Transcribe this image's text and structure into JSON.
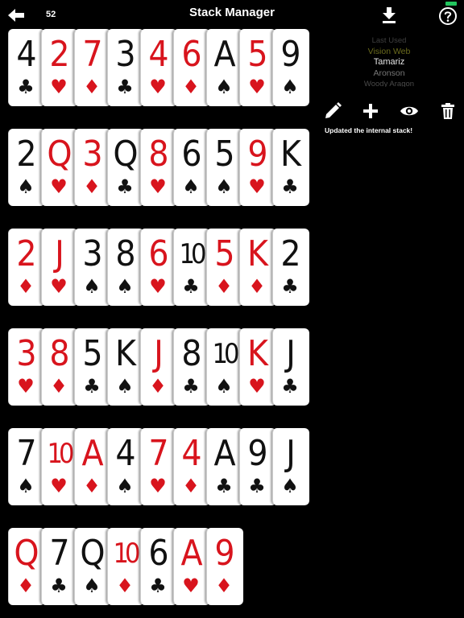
{
  "header": {
    "title": "Stack Manager",
    "card_count": "52",
    "back_icon": "arrow-left-icon",
    "download_icon": "download-icon",
    "help_icon": "question-circle-icon",
    "battery_color": "#22c55e"
  },
  "stack_picker": {
    "options": [
      "Last Used",
      "Vision Web",
      "Tamariz",
      "Aronson",
      "Woody Aragon"
    ],
    "selected": "Tamariz"
  },
  "actions": {
    "icons": [
      "pencil-icon",
      "plus-icon",
      "eye-icon",
      "trash-icon"
    ]
  },
  "status_message": "Updated the internal stack!",
  "colors": {
    "red_suit": "#d8141d",
    "black_suit": "#111111",
    "background": "#000000",
    "card": "#ffffff"
  },
  "cards": [
    {
      "rank": "4",
      "suit": "clubs",
      "symbol": "♣",
      "color": "black"
    },
    {
      "rank": "2",
      "suit": "hearts",
      "symbol": "♥",
      "color": "red"
    },
    {
      "rank": "7",
      "suit": "diamonds",
      "symbol": "♦",
      "color": "red"
    },
    {
      "rank": "3",
      "suit": "clubs",
      "symbol": "♣",
      "color": "black"
    },
    {
      "rank": "4",
      "suit": "hearts",
      "symbol": "♥",
      "color": "red"
    },
    {
      "rank": "6",
      "suit": "diamonds",
      "symbol": "♦",
      "color": "red"
    },
    {
      "rank": "A",
      "suit": "spades",
      "symbol": "♠",
      "color": "black"
    },
    {
      "rank": "5",
      "suit": "hearts",
      "symbol": "♥",
      "color": "red"
    },
    {
      "rank": "9",
      "suit": "spades",
      "symbol": "♠",
      "color": "black"
    },
    {
      "rank": "2",
      "suit": "spades",
      "symbol": "♠",
      "color": "black"
    },
    {
      "rank": "Q",
      "suit": "hearts",
      "symbol": "♥",
      "color": "red"
    },
    {
      "rank": "3",
      "suit": "diamonds",
      "symbol": "♦",
      "color": "red"
    },
    {
      "rank": "Q",
      "suit": "clubs",
      "symbol": "♣",
      "color": "black"
    },
    {
      "rank": "8",
      "suit": "hearts",
      "symbol": "♥",
      "color": "red"
    },
    {
      "rank": "6",
      "suit": "spades",
      "symbol": "♠",
      "color": "black"
    },
    {
      "rank": "5",
      "suit": "spades",
      "symbol": "♠",
      "color": "black"
    },
    {
      "rank": "9",
      "suit": "hearts",
      "symbol": "♥",
      "color": "red"
    },
    {
      "rank": "K",
      "suit": "clubs",
      "symbol": "♣",
      "color": "black"
    },
    {
      "rank": "2",
      "suit": "diamonds",
      "symbol": "♦",
      "color": "red"
    },
    {
      "rank": "J",
      "suit": "hearts",
      "symbol": "♥",
      "color": "red"
    },
    {
      "rank": "3",
      "suit": "spades",
      "symbol": "♠",
      "color": "black"
    },
    {
      "rank": "8",
      "suit": "spades",
      "symbol": "♠",
      "color": "black"
    },
    {
      "rank": "6",
      "suit": "hearts",
      "symbol": "♥",
      "color": "red"
    },
    {
      "rank": "10",
      "suit": "clubs",
      "symbol": "♣",
      "color": "black"
    },
    {
      "rank": "5",
      "suit": "diamonds",
      "symbol": "♦",
      "color": "red"
    },
    {
      "rank": "K",
      "suit": "diamonds",
      "symbol": "♦",
      "color": "red"
    },
    {
      "rank": "2",
      "suit": "clubs",
      "symbol": "♣",
      "color": "black"
    },
    {
      "rank": "3",
      "suit": "hearts",
      "symbol": "♥",
      "color": "red"
    },
    {
      "rank": "8",
      "suit": "diamonds",
      "symbol": "♦",
      "color": "red"
    },
    {
      "rank": "5",
      "suit": "clubs",
      "symbol": "♣",
      "color": "black"
    },
    {
      "rank": "K",
      "suit": "spades",
      "symbol": "♠",
      "color": "black"
    },
    {
      "rank": "J",
      "suit": "diamonds",
      "symbol": "♦",
      "color": "red"
    },
    {
      "rank": "8",
      "suit": "clubs",
      "symbol": "♣",
      "color": "black"
    },
    {
      "rank": "10",
      "suit": "spades",
      "symbol": "♠",
      "color": "black"
    },
    {
      "rank": "K",
      "suit": "hearts",
      "symbol": "♥",
      "color": "red"
    },
    {
      "rank": "J",
      "suit": "clubs",
      "symbol": "♣",
      "color": "black"
    },
    {
      "rank": "7",
      "suit": "spades",
      "symbol": "♠",
      "color": "black"
    },
    {
      "rank": "10",
      "suit": "hearts",
      "symbol": "♥",
      "color": "red"
    },
    {
      "rank": "A",
      "suit": "diamonds",
      "symbol": "♦",
      "color": "red"
    },
    {
      "rank": "4",
      "suit": "spades",
      "symbol": "♠",
      "color": "black"
    },
    {
      "rank": "7",
      "suit": "hearts",
      "symbol": "♥",
      "color": "red"
    },
    {
      "rank": "4",
      "suit": "diamonds",
      "symbol": "♦",
      "color": "red"
    },
    {
      "rank": "A",
      "suit": "clubs",
      "symbol": "♣",
      "color": "black"
    },
    {
      "rank": "9",
      "suit": "clubs",
      "symbol": "♣",
      "color": "black"
    },
    {
      "rank": "J",
      "suit": "spades",
      "symbol": "♠",
      "color": "black"
    },
    {
      "rank": "Q",
      "suit": "diamonds",
      "symbol": "♦",
      "color": "red"
    },
    {
      "rank": "7",
      "suit": "clubs",
      "symbol": "♣",
      "color": "black"
    },
    {
      "rank": "Q",
      "suit": "spades",
      "symbol": "♠",
      "color": "black"
    },
    {
      "rank": "10",
      "suit": "diamonds",
      "symbol": "♦",
      "color": "red"
    },
    {
      "rank": "6",
      "suit": "clubs",
      "symbol": "♣",
      "color": "black"
    },
    {
      "rank": "A",
      "suit": "hearts",
      "symbol": "♥",
      "color": "red"
    },
    {
      "rank": "9",
      "suit": "diamonds",
      "symbol": "♦",
      "color": "red"
    }
  ]
}
